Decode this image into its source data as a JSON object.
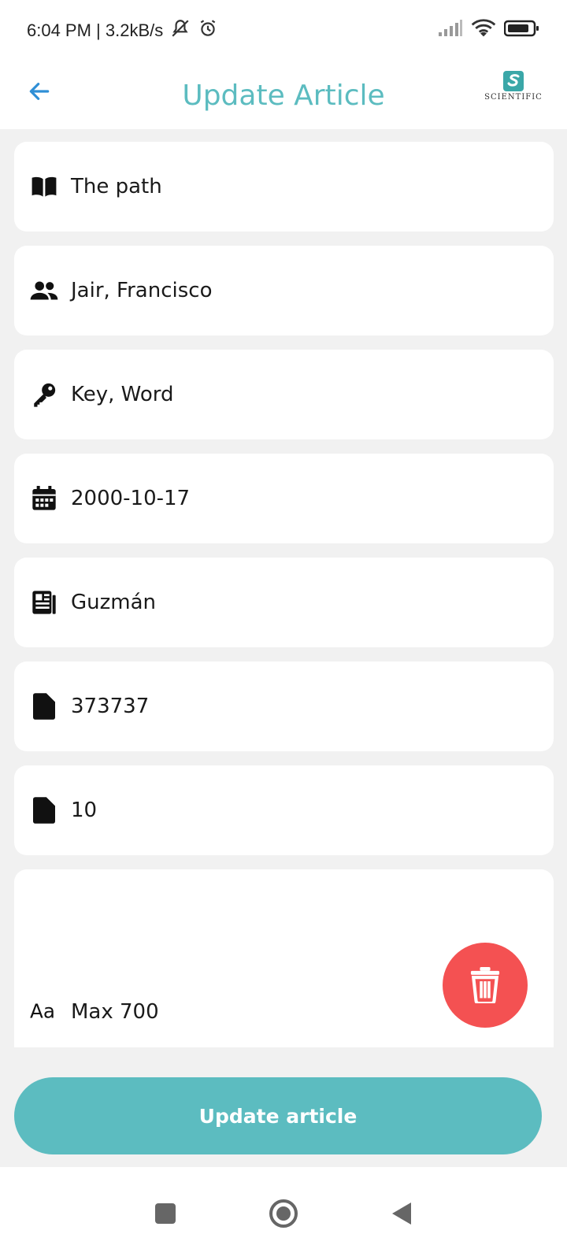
{
  "status_bar": {
    "time_speed": "6:04 PM | 3.2kB/s",
    "icons": [
      "bell-off-icon",
      "alarm-icon",
      "signal-icon",
      "wifi-icon",
      "battery-icon"
    ]
  },
  "app_bar": {
    "title": "Update Article",
    "logo_text": "SCIENTIFIC"
  },
  "fields": [
    {
      "icon": "book-icon",
      "value": "The path"
    },
    {
      "icon": "people-icon",
      "value": "Jair, Francisco"
    },
    {
      "icon": "key-icon",
      "value": "Key, Word"
    },
    {
      "icon": "calendar-icon",
      "value": "2000-10-17"
    },
    {
      "icon": "newspaper-icon",
      "value": "Guzmán"
    },
    {
      "icon": "file-icon",
      "value": "373737"
    },
    {
      "icon": "file-icon",
      "value": "10"
    },
    {
      "icon": "text-format-icon",
      "value": "Max 700"
    }
  ],
  "actions": {
    "update_label": "Update article",
    "delete_icon": "trash-icon"
  },
  "colors": {
    "accent": "#5cbcc0",
    "delete": "#f45152",
    "back_arrow": "#2f8fd6"
  }
}
